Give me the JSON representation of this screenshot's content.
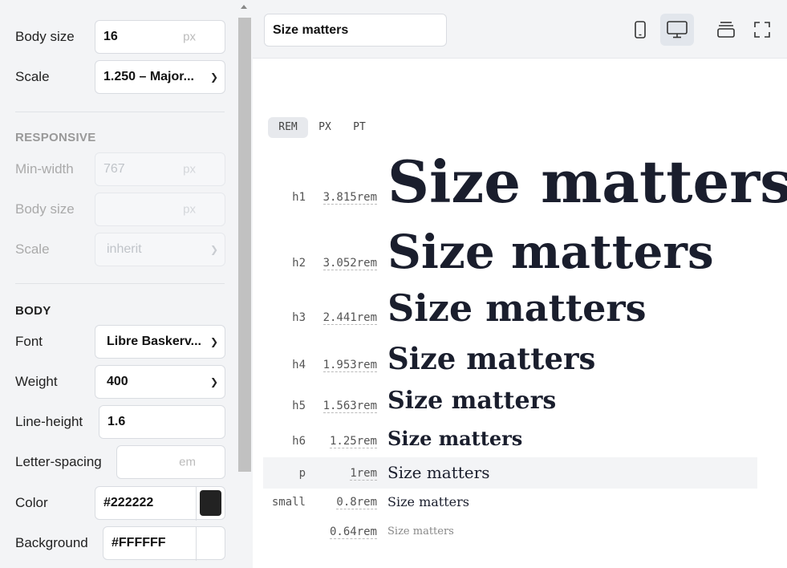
{
  "sidebar": {
    "body_size": {
      "label": "Body size",
      "value": "16",
      "unit": "px"
    },
    "scale": {
      "label": "Scale",
      "value": "1.250 – Major..."
    },
    "responsive": {
      "title": "RESPONSIVE",
      "min_width": {
        "label": "Min-width",
        "placeholder": "767",
        "unit": "px"
      },
      "body_size": {
        "label": "Body size",
        "unit": "px"
      },
      "scale": {
        "label": "Scale",
        "value": "inherit"
      }
    },
    "body": {
      "title": "BODY",
      "font": {
        "label": "Font",
        "value": "Libre Baskerv..."
      },
      "weight": {
        "label": "Weight",
        "value": "400"
      },
      "line_height": {
        "label": "Line-height",
        "value": "1.6"
      },
      "letter_spacing": {
        "label": "Letter-spacing",
        "unit": "em"
      },
      "color": {
        "label": "Color",
        "value": "#222222",
        "swatch": "#222222"
      },
      "background": {
        "label": "Background",
        "value": "#FFFFFF",
        "swatch": "#FFFFFF"
      }
    }
  },
  "toolbar": {
    "preview_text": "Size matters",
    "icons": [
      "mobile-icon",
      "desktop-icon",
      "layers-icon",
      "fullscreen-icon"
    ]
  },
  "unit_tabs": [
    "REM",
    "PX",
    "PT"
  ],
  "scale_rows": [
    {
      "tag": "h1",
      "size": "3.815rem",
      "text": "Size matters"
    },
    {
      "tag": "h2",
      "size": "3.052rem",
      "text": "Size matters"
    },
    {
      "tag": "h3",
      "size": "2.441rem",
      "text": "Size matters"
    },
    {
      "tag": "h4",
      "size": "1.953rem",
      "text": "Size matters"
    },
    {
      "tag": "h5",
      "size": "1.563rem",
      "text": "Size matters"
    },
    {
      "tag": "h6",
      "size": "1.25rem",
      "text": "Size matters"
    },
    {
      "tag": "p",
      "size": "1rem",
      "text": "Size matters"
    },
    {
      "tag": "small",
      "size": "0.8rem",
      "text": "Size matters"
    },
    {
      "tag": "",
      "size": "0.64rem",
      "text": "Size matters"
    }
  ]
}
